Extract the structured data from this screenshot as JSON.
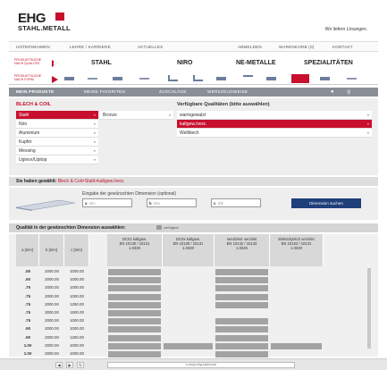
{
  "header": {
    "logo_main": "EHG",
    "logo_sub": "STAHL.METALL",
    "slogan": "Wir liefern Lösungen."
  },
  "nav": {
    "left": [
      "UNTERNEHMEN",
      "LEHRE / KARRIERE",
      "AKTUELLES"
    ],
    "right": [
      "ABMELDEN",
      "WARENKORB (0)",
      "KONTAKT"
    ]
  },
  "categories": {
    "label_top": "PRODUKTSUCHE NACH QUALITÄT",
    "label_bottom": "PRODUKTSUCHE NACH FORM",
    "tabs": [
      "STAHL",
      "NIRO",
      "NE-METALLE",
      "SPEZIALITÄTEN"
    ]
  },
  "breadcrumb_bar": {
    "items": [
      "MEIN PRODUKTE",
      "MEINE FAVORITEN",
      "ZUSCHLÄGE",
      "WERKZEUGWEISE"
    ]
  },
  "products": {
    "title": "BLECH & COIL",
    "items": [
      "Stahl",
      "Niro",
      "Aluminium",
      "Kupfer",
      "Messing",
      "Uginox/Upitop"
    ],
    "selected": "Stahl",
    "subitems": [
      "Bronze"
    ]
  },
  "qualities": {
    "title": "Verfügbare Qualitäten (bitte auswählen)",
    "items": [
      "warmgewalzt",
      "kaltgew./verz.",
      "Wellblech"
    ],
    "selected": "kaltgew./verz."
  },
  "chosen": {
    "label": "Sie haben gewählt:",
    "value": "Blech & Coil>Stahl>kaltgew./verz."
  },
  "dimensions": {
    "label": "Eingabe der gewünschten Dimension (optional)",
    "inputs": [
      {
        "key": "a",
        "unit": "mm"
      },
      {
        "key": "b",
        "unit": "mm"
      },
      {
        "key": "c",
        "unit": "Stk"
      }
    ],
    "button": "Dimension suchen"
  },
  "table": {
    "title": "Qualität in der gewünschten Dimension auswählen:",
    "legend": "verfügbar",
    "columns": [
      "a [mm]",
      "b [mm]",
      "c [mm]"
    ],
    "quality_columns": [
      {
        "name": "DC01 kaltgew.",
        "norm": "EN 10130 / 10131",
        "code": "1.0330"
      },
      {
        "name": "DC0x kaltgew.",
        "norm": "EN 10130 / 10131",
        "code": "1.0330"
      },
      {
        "name": "sendzimir verzinkt",
        "norm": "EN 10142 / 10143",
        "code": "1.0226"
      },
      {
        "name": "Elektrolytisch verzinkt",
        "norm": "EN 10152 / 10131",
        "code": "1.0330"
      }
    ],
    "rows": [
      {
        "a": ".50",
        "b": "2000.00",
        "c": "1000.00",
        "avail": [
          1,
          0,
          1,
          0
        ]
      },
      {
        "a": ".60",
        "b": "2000.00",
        "c": "1000.00",
        "avail": [
          1,
          0,
          1,
          0
        ]
      },
      {
        "a": ".75",
        "b": "2000.00",
        "c": "1000.00",
        "avail": [
          1,
          0,
          1,
          0
        ]
      },
      {
        "a": ".75",
        "b": "2000.00",
        "c": "1000.00",
        "avail": [
          1,
          0,
          1,
          0
        ]
      },
      {
        "a": ".75",
        "b": "2000.00",
        "c": "1250.00",
        "avail": [
          1,
          0,
          1,
          0
        ]
      },
      {
        "a": ".75",
        "b": "3000.00",
        "c": "1500.00",
        "avail": [
          1,
          0,
          0,
          0
        ]
      },
      {
        "a": ".75",
        "b": "2000.00",
        "c": "1000.00",
        "avail": [
          1,
          0,
          1,
          0
        ]
      },
      {
        "a": ".90",
        "b": "2000.00",
        "c": "1000.00",
        "avail": [
          1,
          0,
          1,
          0
        ]
      },
      {
        "a": ".90",
        "b": "2000.00",
        "c": "1250.00",
        "avail": [
          1,
          0,
          1,
          0
        ]
      },
      {
        "a": "1.00",
        "b": "2000.00",
        "c": "1000.00",
        "avail": [
          1,
          1,
          1,
          1
        ]
      },
      {
        "a": "1.00",
        "b": "2000.00",
        "c": "1000.00",
        "avail": [
          1,
          0,
          1,
          0
        ]
      }
    ]
  },
  "browser": {
    "url": "e-shop.ehg-stahl.com"
  },
  "colors": {
    "accent": "#c8102e",
    "button": "#1f3f7a",
    "available": "#a3a3a3"
  }
}
